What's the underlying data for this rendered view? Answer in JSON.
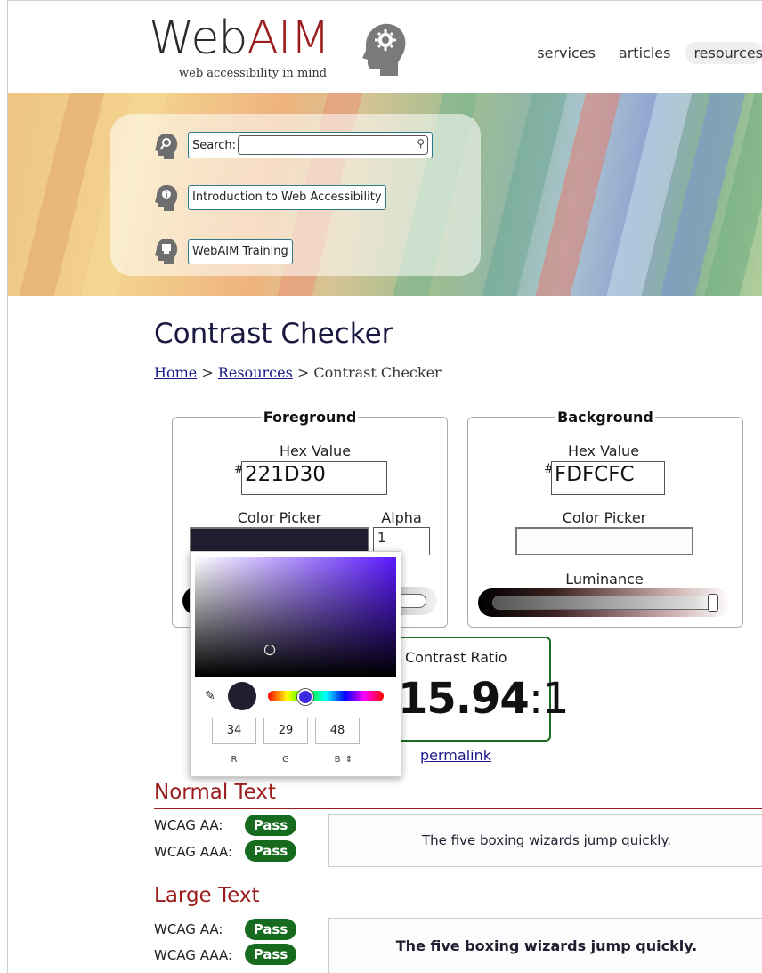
{
  "header": {
    "logo_web": "Web",
    "logo_aim": "AIM",
    "tagline": "web accessibility in mind",
    "nav": [
      "services",
      "articles",
      "resources"
    ]
  },
  "quicklinks": {
    "search_label": "Search:",
    "intro_link": "Introduction to Web Accessibility",
    "training_link": "WebAIM Training"
  },
  "page": {
    "title": "Contrast Checker",
    "breadcrumb": {
      "home": "Home",
      "sep": ">",
      "resources": "Resources",
      "current": "Contrast Checker"
    }
  },
  "foreground": {
    "legend": "Foreground",
    "hex_label": "Hex Value",
    "hash": "#",
    "hex": "221D30",
    "picker_label": "Color Picker",
    "alpha_label": "Alpha",
    "alpha": "1",
    "swatch_color": "#221d30"
  },
  "background": {
    "legend": "Background",
    "hex_label": "Hex Value",
    "hash": "#",
    "hex": "FDFCFC",
    "picker_label": "Color Picker",
    "luminance_label": "Luminance",
    "swatch_color": "#fdfcfc"
  },
  "picker": {
    "r": "34",
    "g": "29",
    "b": "48",
    "r_label": "R",
    "g_label": "G",
    "b_label": "B",
    "mode_toggle": "⇕"
  },
  "ratio": {
    "label": "Contrast Ratio",
    "value": "15.94",
    "suffix": ":1",
    "permalink": "permalink"
  },
  "normal_text": {
    "title": "Normal Text",
    "aa_label": "WCAG AA:",
    "aaa_label": "WCAG AAA:",
    "aa_result": "Pass",
    "aaa_result": "Pass",
    "sample": "The five boxing wizards jump quickly."
  },
  "large_text": {
    "title": "Large Text",
    "aa_label": "WCAG AA:",
    "aaa_label": "WCAG AAA:",
    "aa_result": "Pass",
    "aaa_result": "Pass",
    "sample": "The five boxing wizards jump quickly."
  },
  "colors": {
    "brand_red": "#9b1c1c",
    "pass_green": "#176b1f",
    "focus_teal": "#2c7a87"
  }
}
